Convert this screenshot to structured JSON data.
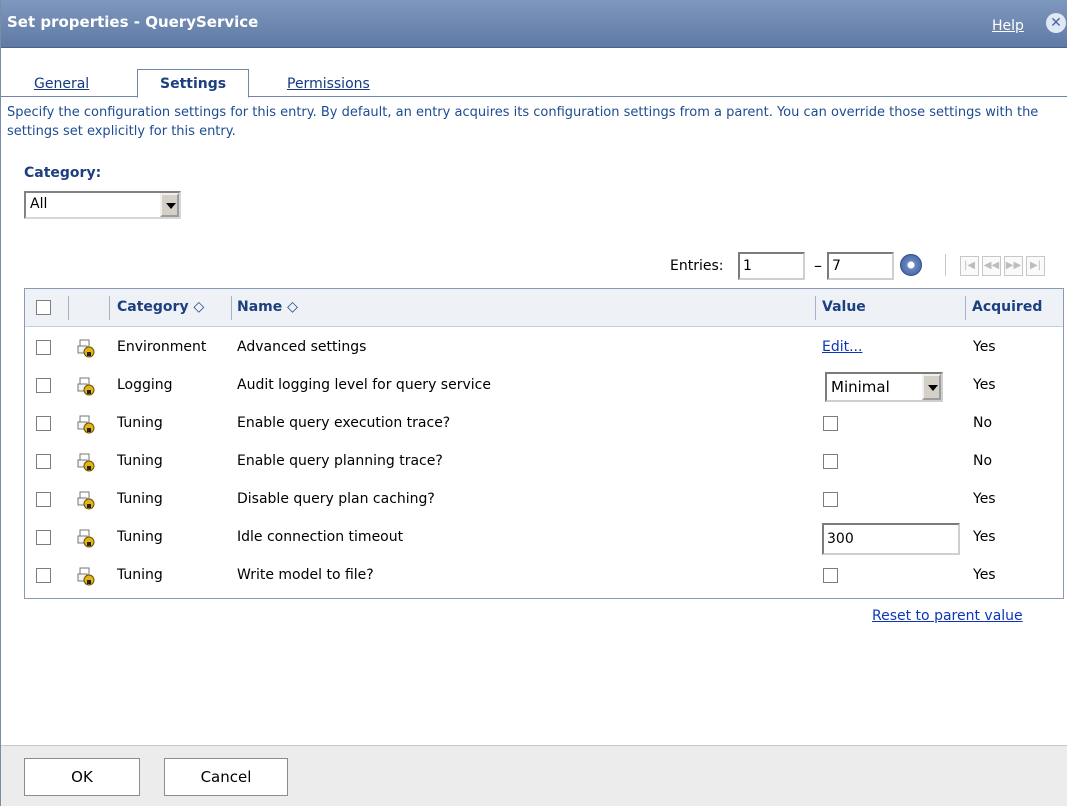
{
  "window": {
    "title": "Set properties - QueryService",
    "help_label": "Help",
    "close_glyph": "✕"
  },
  "tabs": [
    {
      "label": "General",
      "active": false
    },
    {
      "label": "Settings",
      "active": true
    },
    {
      "label": "Permissions",
      "active": false
    }
  ],
  "description": "Specify the configuration settings for this entry. By default, an entry acquires its configuration settings from a parent. You can override those settings with the settings set explicitly for this entry.",
  "category": {
    "label": "Category:",
    "selected": "All"
  },
  "entries": {
    "label": "Entries:",
    "from": "1",
    "dash": "–",
    "to": "7"
  },
  "grid": {
    "headers": {
      "category": "Category ◇",
      "name": "Name ◇",
      "value": "Value",
      "acquired": "Acquired"
    },
    "rows": [
      {
        "category": "Environment",
        "name": "Advanced settings",
        "value_type": "link",
        "value": "Edit...",
        "acquired": "Yes"
      },
      {
        "category": "Logging",
        "name": "Audit logging level for query service",
        "value_type": "select",
        "value": "Minimal",
        "acquired": "Yes"
      },
      {
        "category": "Tuning",
        "name": "Enable query execution trace?",
        "value_type": "checkbox",
        "value": "",
        "acquired": "No"
      },
      {
        "category": "Tuning",
        "name": "Enable query planning trace?",
        "value_type": "checkbox",
        "value": "",
        "acquired": "No"
      },
      {
        "category": "Tuning",
        "name": "Disable query plan caching?",
        "value_type": "checkbox",
        "value": "",
        "acquired": "Yes"
      },
      {
        "category": "Tuning",
        "name": "Idle connection timeout",
        "value_type": "input",
        "value": "300",
        "acquired": "Yes"
      },
      {
        "category": "Tuning",
        "name": "Write model to file?",
        "value_type": "checkbox",
        "value": "",
        "acquired": "Yes"
      }
    ]
  },
  "reset_link": "Reset to parent value",
  "footer": {
    "ok_label": "OK",
    "cancel_label": "Cancel"
  },
  "colors": {
    "title_bar": "#6d88b3",
    "heading_text": "#1c3f7f",
    "link": "#0c35b8"
  }
}
